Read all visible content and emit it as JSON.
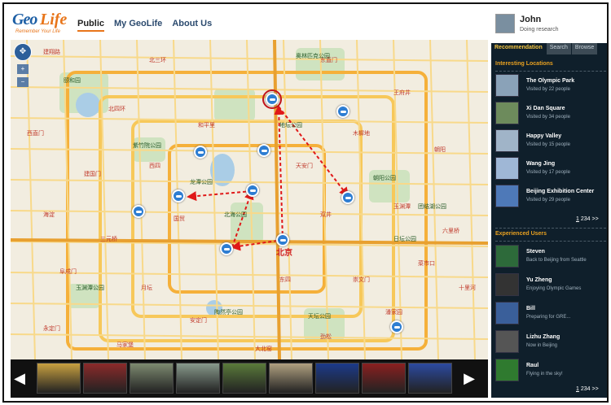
{
  "header": {
    "logo_main": "Geo",
    "logo_accent": "Life",
    "logo_tagline": "Remember Your Life",
    "nav": [
      {
        "label": "Public"
      },
      {
        "label": "My GeoLife"
      },
      {
        "label": "About Us"
      }
    ]
  },
  "user": {
    "name": "John",
    "status": "Doing research"
  },
  "tabs": [
    {
      "label": "Recommendation"
    },
    {
      "label": "Search"
    },
    {
      "label": "Browse"
    }
  ],
  "map": {
    "center_label": "北京",
    "labels": [
      "建翔路",
      "北三环",
      "北四环",
      "西直门",
      "东直门",
      "木樨地",
      "建国门",
      "西四",
      "和平里",
      "天安门",
      "王府井",
      "朝阳",
      "海淀",
      "三元桥",
      "国贸",
      "双井",
      "玉渊潭",
      "六里桥",
      "阜成门",
      "月坛",
      "安定门",
      "东四",
      "崇文门",
      "菜市口",
      "永定门",
      "马家堡",
      "大北窑",
      "劲松",
      "潘家园",
      "十里河"
    ],
    "green_labels": [
      "奥林匹克公园",
      "颐和园",
      "紫竹院公园",
      "北海公园",
      "天坛公园",
      "朝阳公园",
      "陶然亭公园",
      "地坛公园",
      "日坛公园",
      "团结湖公园",
      "玉渊潭公园",
      "龙潭公园"
    ]
  },
  "recommend": {
    "section_title": "Interesting Locations",
    "locations": [
      {
        "title": "The Olympic Park",
        "subtitle": "Visited by 22 people"
      },
      {
        "title": "Xi Dan Square",
        "subtitle": "Visited by 34 people"
      },
      {
        "title": "Happy Valley",
        "subtitle": "Visited by 15 people"
      },
      {
        "title": "Wang Jing",
        "subtitle": "Visited by 17 people"
      },
      {
        "title": "Beijing Exhibition Center",
        "subtitle": "Visited by 29 people"
      }
    ],
    "pager": [
      "1",
      "2",
      "3",
      "4",
      ">>"
    ]
  },
  "experts": {
    "section_title": "Experienced Users",
    "users": [
      {
        "name": "Steven",
        "subtitle": "Back to Beijing from Seattle"
      },
      {
        "name": "Yu Zheng",
        "subtitle": "Enjoying Olympic Games"
      },
      {
        "name": "Bill",
        "subtitle": "Preparing for GRE..."
      },
      {
        "name": "Lizhu Zhang",
        "subtitle": "Now in Beijing"
      },
      {
        "name": "Raul",
        "subtitle": "Flying in the sky!"
      }
    ],
    "pager": [
      "1",
      "2",
      "3",
      "4",
      ">>"
    ]
  },
  "filmstrip": {
    "prev": "◀",
    "next": "▶"
  },
  "colors": {
    "accent": "#e8751a",
    "panel_bg": "#0f1f2b",
    "section_title": "#e8a020",
    "marker": "#2d7dd2",
    "route": "#e01818"
  }
}
